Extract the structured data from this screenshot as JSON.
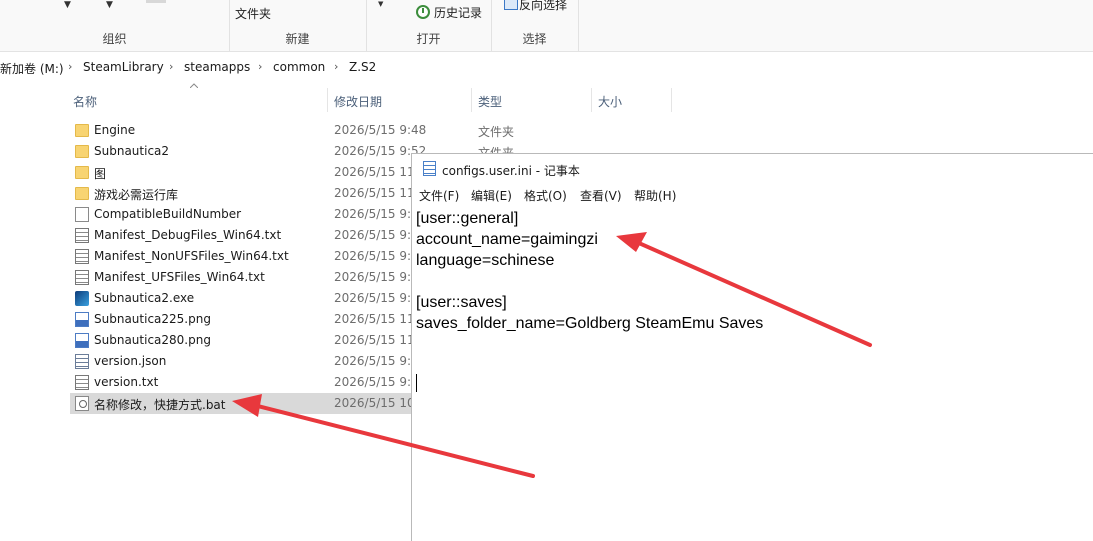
{
  "ribbon": {
    "groups": [
      "组织",
      "新建",
      "打开",
      "选择"
    ],
    "new_folder_label": "文件夹",
    "history_label": "历史记录",
    "invert_selection_label": "反向选择"
  },
  "address": {
    "crumbs": [
      "新加卷 (M:)",
      "SteamLibrary",
      "steamapps",
      "common",
      "Z.S2"
    ]
  },
  "columns": {
    "name": "名称",
    "modified": "修改日期",
    "type": "类型",
    "size": "大小"
  },
  "files": [
    {
      "name": "Engine",
      "date": "2026/5/15 9:48",
      "type": "文件夹",
      "icon": "folder-icon"
    },
    {
      "name": "Subnautica2",
      "date": "2026/5/15 9:52",
      "type": "文件夹",
      "icon": "folder-icon"
    },
    {
      "name": "图",
      "date": "2026/5/15 11",
      "type": "",
      "icon": "folder-icon"
    },
    {
      "name": "游戏必需运行库",
      "date": "2026/5/15 11",
      "type": "",
      "icon": "folder-icon"
    },
    {
      "name": "CompatibleBuildNumber",
      "date": "2026/5/15 9:4",
      "type": "",
      "icon": "file-icon"
    },
    {
      "name": "Manifest_DebugFiles_Win64.txt",
      "date": "2026/5/15 9:1",
      "type": "",
      "icon": "text-file-icon"
    },
    {
      "name": "Manifest_NonUFSFiles_Win64.txt",
      "date": "2026/5/15 9:1",
      "type": "",
      "icon": "text-file-icon"
    },
    {
      "name": "Manifest_UFSFiles_Win64.txt",
      "date": "2026/5/15 9:1",
      "type": "",
      "icon": "text-file-icon"
    },
    {
      "name": "Subnautica2.exe",
      "date": "2026/5/15 9:1",
      "type": "",
      "icon": "exe-icon"
    },
    {
      "name": "Subnautica225.png",
      "date": "2026/5/15 11",
      "type": "",
      "icon": "png-file-icon"
    },
    {
      "name": "Subnautica280.png",
      "date": "2026/5/15 11",
      "type": "",
      "icon": "png-file-icon"
    },
    {
      "name": "version.json",
      "date": "2026/5/15 9:3",
      "type": "",
      "icon": "json-file-icon"
    },
    {
      "name": "version.txt",
      "date": "2026/5/15 9:3",
      "type": "",
      "icon": "text-file-icon"
    },
    {
      "name": "名称修改，快捷方式.bat",
      "date": "2026/5/15 10",
      "type": "",
      "icon": "bat-file-icon"
    }
  ],
  "notepad": {
    "title": "configs.user.ini - 记事本",
    "menu": [
      "文件(F)",
      "编辑(E)",
      "格式(O)",
      "查看(V)",
      "帮助(H)"
    ],
    "lines": [
      "[user::general]",
      "account_name=gaimingzi",
      "language=schinese",
      "",
      "[user::saves]",
      "saves_folder_name=Goldberg SteamEmu Saves"
    ]
  },
  "colors": {
    "annotation_arrow": "#e8383d",
    "selected_row": "#d9d9d9",
    "folder": "#f8d472"
  }
}
